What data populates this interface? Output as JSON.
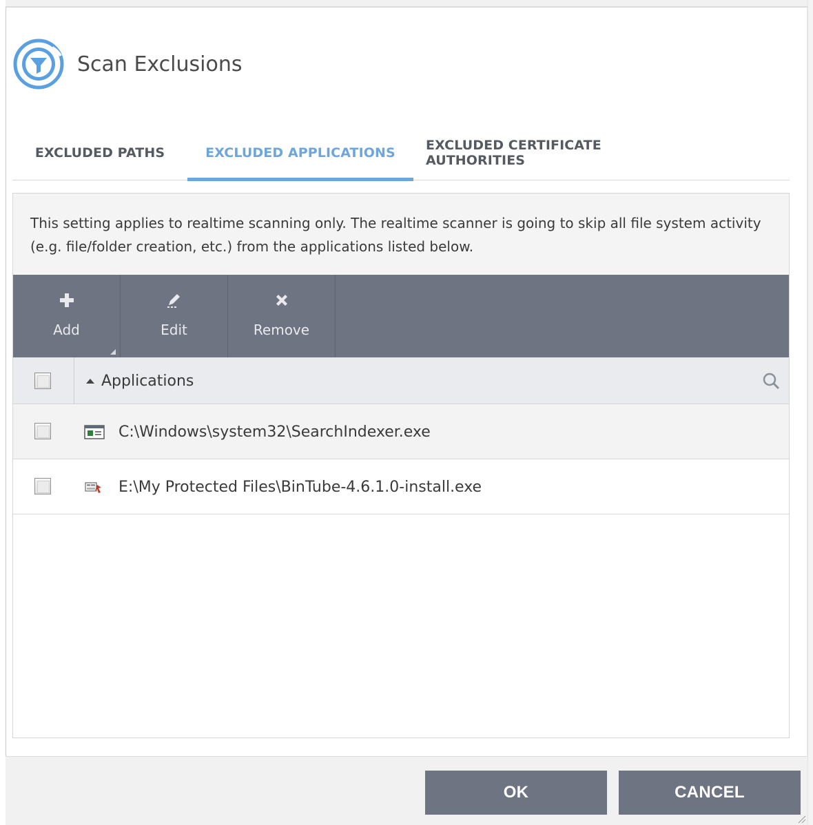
{
  "dialog": {
    "title": "Scan Exclusions",
    "logo_icon": "scan-exclusions-filter-icon"
  },
  "tabs": [
    {
      "label": "EXCLUDED PATHS",
      "active": false
    },
    {
      "label": "EXCLUDED APPLICATIONS",
      "active": true
    },
    {
      "label": "EXCLUDED CERTIFICATE AUTHORITIES",
      "active": false
    }
  ],
  "info_text": "This setting applies to realtime scanning only. The realtime scanner is going to skip all file system activity (e.g. file/folder creation, etc.) from the applications listed below.",
  "toolbar": {
    "add": {
      "label": "Add",
      "icon": "plus-icon"
    },
    "edit": {
      "label": "Edit",
      "icon": "pencil-icon"
    },
    "remove": {
      "label": "Remove",
      "icon": "x-icon"
    }
  },
  "grid": {
    "column_header": "Applications",
    "sort": "ascending",
    "rows": [
      {
        "path": "C:\\Windows\\system32\\SearchIndexer.exe",
        "icon": "windows-app-icon",
        "checked": false
      },
      {
        "path": "E:\\My Protected Files\\BinTube-4.6.1.0-install.exe",
        "icon": "installer-icon",
        "checked": false
      }
    ]
  },
  "buttons": {
    "ok": "OK",
    "cancel": "CANCEL"
  },
  "colors": {
    "accent": "#6ea5db",
    "toolbar": "#6f7482",
    "button": "#6f7482"
  }
}
